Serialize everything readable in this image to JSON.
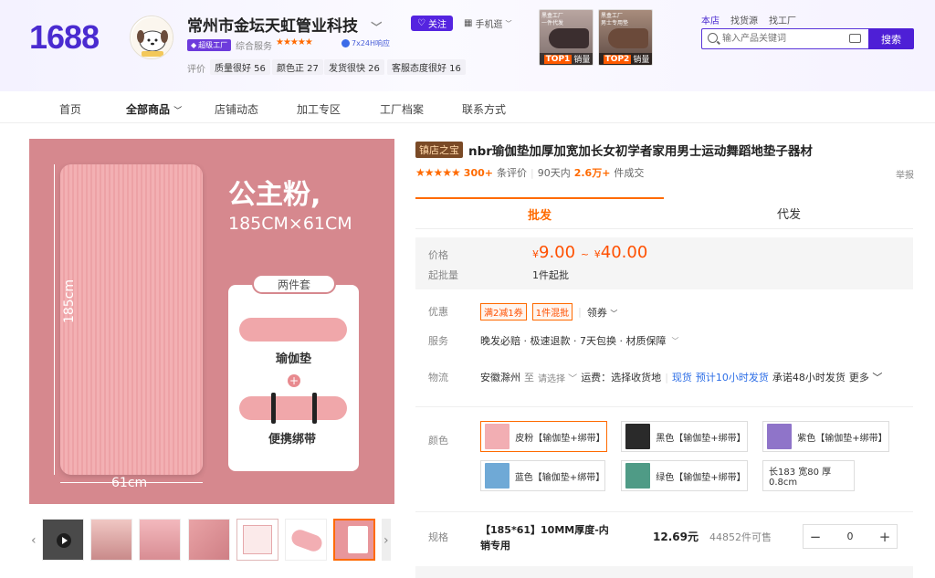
{
  "header": {
    "logo": "1688",
    "shop_name": "常州市金坛天虹管业科技",
    "follow_label": "关注",
    "mobile_label": "手机逛",
    "super_factory": "超级工厂",
    "service_label": "综合服务",
    "stars": "★★★★★",
    "response_badge": "7x24H响应",
    "rating_label": "评价",
    "ratings": [
      {
        "text": "质量很好 56"
      },
      {
        "text": "颜色正 27"
      },
      {
        "text": "发货很快 26"
      },
      {
        "text": "客服态度很好 16"
      }
    ],
    "promos": [
      {
        "caption": "黑盒工厂\n一件代发",
        "rank": "TOP1",
        "label": "销量"
      },
      {
        "caption": "黑盒工厂\n男士专用垫",
        "rank": "TOP2",
        "label": "销量"
      }
    ],
    "scopes": [
      "本店",
      "找货源",
      "找工厂"
    ],
    "search_placeholder": "输入产品关键词",
    "search_button": "搜索"
  },
  "nav": {
    "items": [
      "首页",
      "全部商品",
      "店铺动态",
      "加工专区",
      "工厂档案",
      "联系方式"
    ]
  },
  "image": {
    "title1": "公主粉,",
    "title2": "185CM×61CM",
    "dim_v": "185cm",
    "dim_h": "61cm",
    "set_tag": "两件套",
    "item1": "瑜伽垫",
    "item2": "便携绑带"
  },
  "product": {
    "badge": "镇店之宝",
    "title": "nbr瑜伽垫加厚加宽加长女初学者家用男士运动舞蹈地垫子器材",
    "stars": "★★★★★",
    "review_count": "300+",
    "review_suffix": "条评价",
    "sales_prefix": "90天内",
    "sales_count": "2.6万+",
    "sales_suffix": "件成交",
    "report": "举报",
    "tabs": [
      "批发",
      "代发"
    ],
    "price_label": "价格",
    "price_min": "9.00",
    "price_max": "40.00",
    "currency": "¥",
    "price_sep": "~",
    "moq_label": "起批量",
    "moq_value": "1件起批",
    "discount_label": "优惠",
    "coupons": [
      "满2减1券",
      "1件混批"
    ],
    "coupon_more": "领券",
    "service_label": "服务",
    "service_value": "晚发必赔 · 极速退款 · 7天包换 · 材质保障",
    "logistics_label": "物流",
    "from": "安徽滁州",
    "to_label": "至",
    "to_select": "请选择",
    "freight": "运费：选择收货地",
    "spot": "现货",
    "eta": "预计10小时发货",
    "promise": "承诺48小时发货",
    "more": "更多",
    "color_label": "颜色",
    "colors": [
      {
        "name": "皮粉【输伽垫+绑带】",
        "hex": "#f2aeb3"
      },
      {
        "name": "黑色【输伽垫+绑带】",
        "hex": "#2a2a2a"
      },
      {
        "name": "紫色【输伽垫+绑带】",
        "hex": "#8f74c9"
      },
      {
        "name": "蓝色【输伽垫+绑带】",
        "hex": "#6fa9d6"
      },
      {
        "name": "绿色【输伽垫+绑带】",
        "hex": "#4f9b86"
      },
      {
        "name": "长183 宽80 厚0.8cm",
        "hex": ""
      }
    ],
    "spec_label": "规格",
    "spec_name": "【185*61】10MM厚度-内销专用",
    "spec_price": "12.69元",
    "spec_stock": "44852件可售",
    "quantity": "0"
  },
  "colors": {
    "brand": "#4a2bd0",
    "accent": "#ff6a00",
    "price": "#ff5000"
  }
}
